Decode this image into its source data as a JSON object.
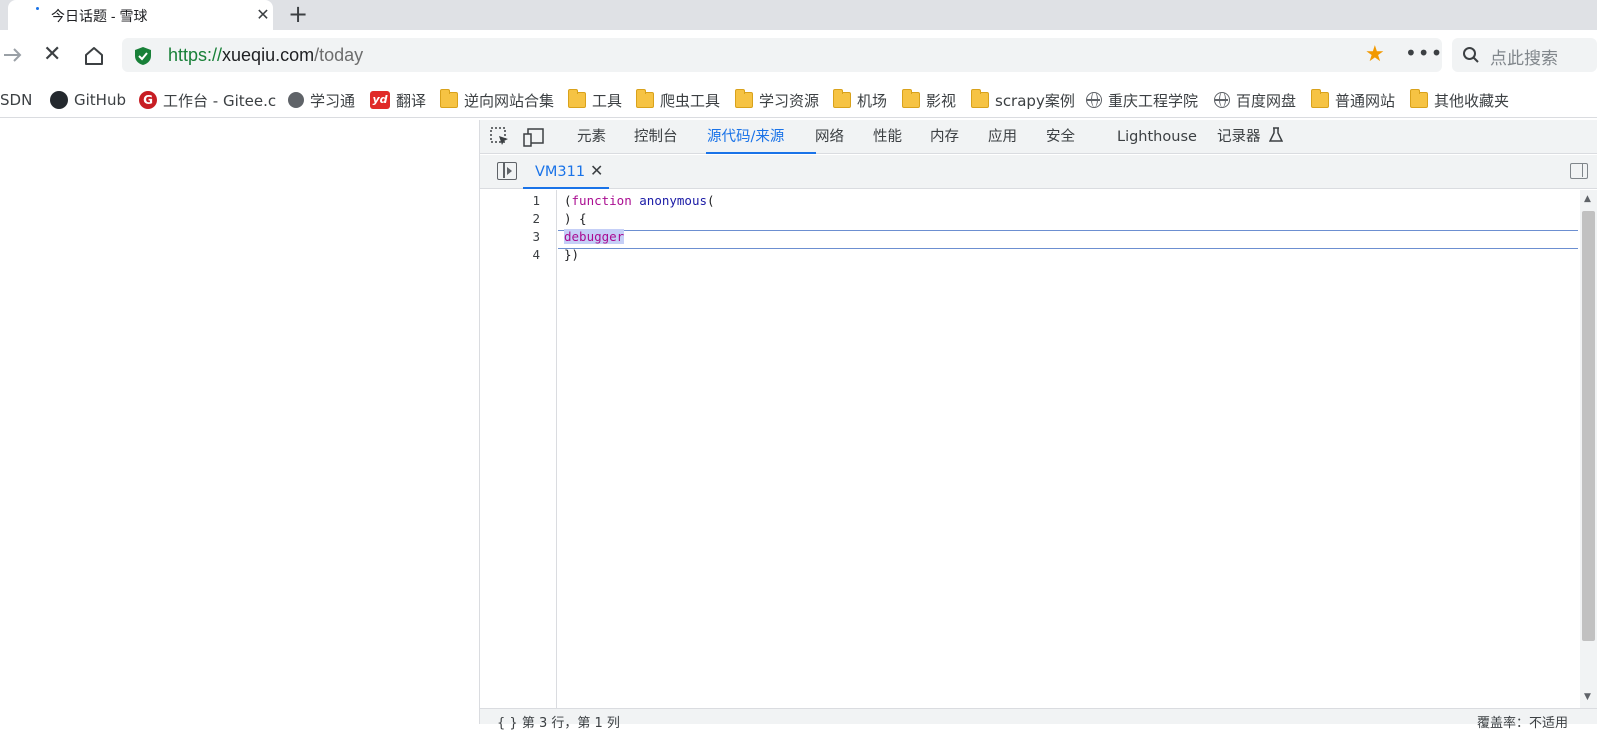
{
  "browser": {
    "tab": {
      "title": "今日话题 - 雪球",
      "close": "✕"
    },
    "new_tab": "+",
    "forward_icon": "arrow-right-icon",
    "stop_icon": "✕",
    "url": {
      "scheme": "https://",
      "host": "xueqiu.com",
      "path": "/today"
    },
    "star": "★",
    "more": "•••",
    "search_placeholder": "点此搜索",
    "colors": {
      "secure": "#188038",
      "star": "#f29900",
      "accent": "#1a73e8"
    }
  },
  "bookmarks": [
    {
      "label": "SDN",
      "icon": "none"
    },
    {
      "label": "GitHub",
      "icon": "github-icon"
    },
    {
      "label": "工作台 - Gitee.c",
      "icon": "gitee-icon",
      "glyph": "G"
    },
    {
      "label": "学习通",
      "icon": "globe-icon"
    },
    {
      "label": "翻译",
      "icon": "youdao-icon",
      "glyph": "yd"
    },
    {
      "label": "逆向网站合集",
      "icon": "folder-icon"
    },
    {
      "label": "工具",
      "icon": "folder-icon"
    },
    {
      "label": "爬虫工具",
      "icon": "folder-icon"
    },
    {
      "label": "学习资源",
      "icon": "folder-icon"
    },
    {
      "label": "机场",
      "icon": "folder-icon"
    },
    {
      "label": "影视",
      "icon": "folder-icon"
    },
    {
      "label": "scrapy案例",
      "icon": "folder-icon"
    },
    {
      "label": "重庆工程学院",
      "icon": "globe-icon"
    },
    {
      "label": "百度网盘",
      "icon": "globe-icon"
    },
    {
      "label": "普通网站",
      "icon": "folder-icon"
    },
    {
      "label": "其他收藏夹",
      "icon": "folder-icon"
    }
  ],
  "devtools": {
    "tabs": [
      "元素",
      "控制台",
      "源代码/来源",
      "网络",
      "性能",
      "内存",
      "应用",
      "安全",
      "Lighthouse",
      "记录器"
    ],
    "active_tab": "源代码/来源",
    "recorder_icon": "flask-icon",
    "file_tab": {
      "name": "VM311",
      "close": "✕"
    },
    "code": {
      "line_numbers": [
        "1",
        "2",
        "3",
        "4"
      ],
      "lines": [
        {
          "p1": "(",
          "kw": "function",
          "sp": " ",
          "fn": "anonymous",
          "p2": "("
        },
        {
          "text": ") {"
        },
        {
          "selected": "debugger"
        },
        {
          "text": "})"
        }
      ]
    },
    "status": {
      "left": "第 3 行，第 1 列",
      "right": "覆盖率：不适用",
      "left_icon": "{ }"
    }
  }
}
